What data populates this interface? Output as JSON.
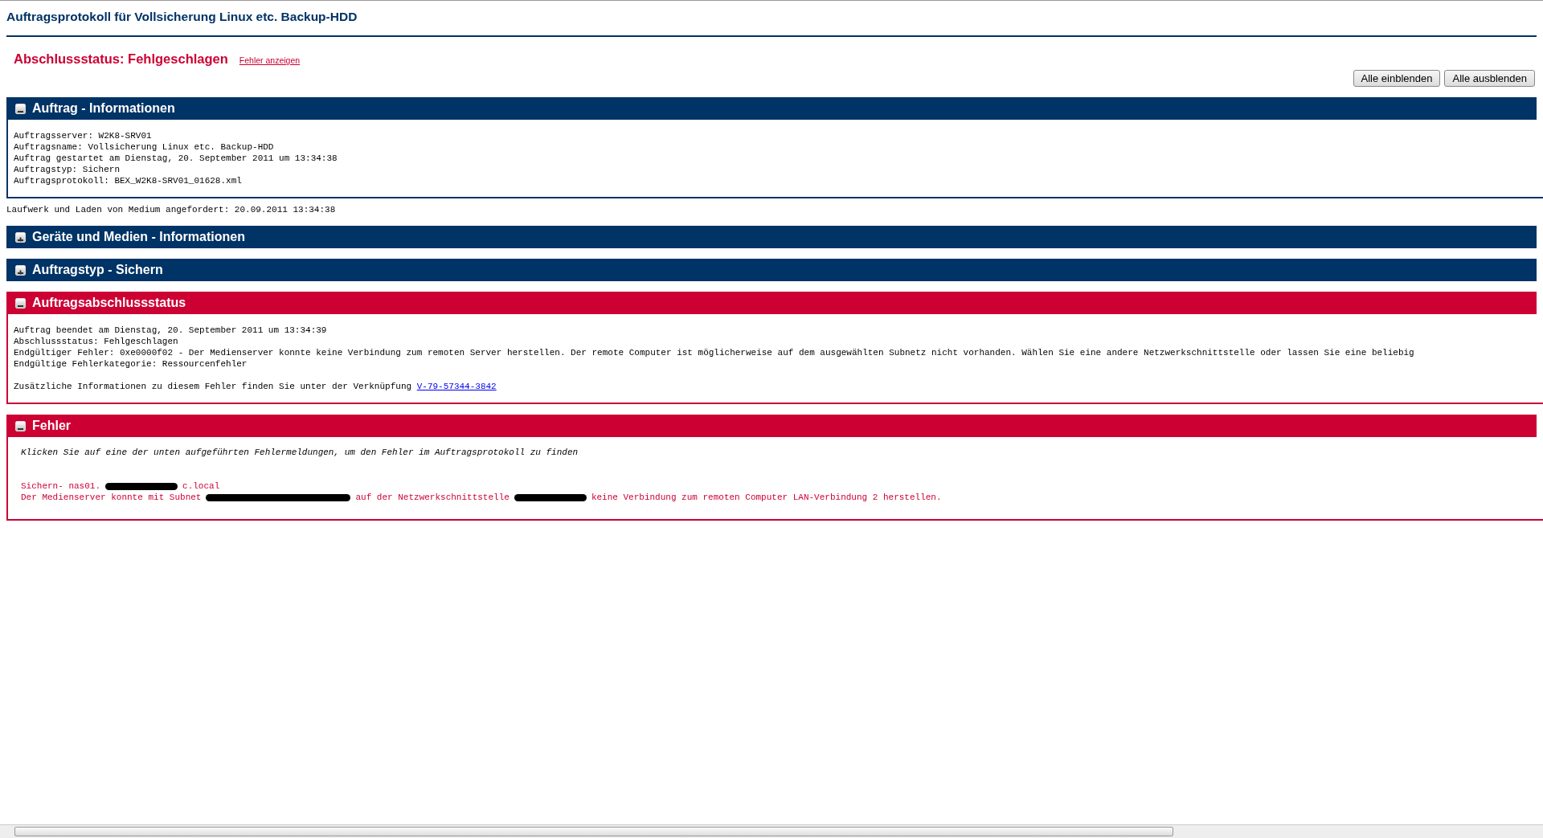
{
  "title": "Auftragsprotokoll für Vollsicherung Linux etc. Backup-HDD",
  "status": {
    "text": "Abschlussstatus: Fehlgeschlagen",
    "link": "Fehler anzeigen"
  },
  "buttons": [
    "Alle einblenden",
    "Alle ausblenden"
  ],
  "sections": [
    {
      "title": "Auftrag - Informationen",
      "kind": "info",
      "expanded": true,
      "lines": [
        {
          "text": "Auftragsserver: W2K8-SRV01"
        },
        {
          "text": "Auftragsname: Vollsicherung Linux etc. Backup-HDD"
        },
        {
          "text": "Auftrag gestartet am Dienstag, 20. September 2011 um 13:34:38"
        },
        {
          "text": "Auftragstyp: Sichern"
        },
        {
          "text": "Auftragsprotokoll: BEX_W2K8-SRV01_01628.xml"
        }
      ],
      "after": "Laufwerk und Laden von Medium angefordert: 20.09.2011 13:34:38"
    },
    {
      "title": "Geräte und Medien - Informationen",
      "kind": "info",
      "expanded": false
    },
    {
      "title": "Auftragstyp - Sichern",
      "kind": "info",
      "expanded": false
    },
    {
      "title": "Auftragsabschlussstatus",
      "kind": "error",
      "expanded": true,
      "lines": [
        {
          "text": "Auftrag beendet am Dienstag, 20. September 2011 um 13:34:39"
        },
        {
          "text": "Abschlussstatus: Fehlgeschlagen"
        },
        {
          "text": "Endgültiger Fehler: 0xe0000f02 - Der Medienserver konnte keine Verbindung zum remoten Server herstellen. Der remote Computer ist möglicherweise auf dem ausgewählten Subnetz nicht vorhanden. Wählen Sie eine andere Netzwerkschnittstelle oder lassen Sie eine beliebig"
        },
        {
          "text": "Endgültige Fehlerkategorie: Ressourcenfehler"
        },
        {
          "text": "Zusätzliche Informationen zu diesem Fehler finden Sie unter der Verknüpfung",
          "link": "V-79-57344-3842",
          "gap_before": true
        }
      ]
    },
    {
      "title": "Fehler",
      "kind": "error",
      "expanded": true,
      "intro": "Klicken Sie auf eine der unten aufgeführten Fehlermeldungen, um den Fehler im Auftragsprotokoll zu finden",
      "errors": [
        {
          "lines": [
            [
              {
                "kind": "text",
                "text": "Sichern- nas01."
              },
              {
                "kind": "redacted"
              },
              {
                "kind": "text",
                "text": "c.local"
              }
            ],
            [
              {
                "kind": "text",
                "text": "Der Medienserver konnte mit Subnet"
              },
              {
                "kind": "redacted"
              },
              {
                "kind": "text",
                "text": "auf der Netzwerkschnittstelle"
              },
              {
                "kind": "redacted"
              },
              {
                "kind": "text",
                "text": "keine Verbindung zum remoten Computer LAN-Verbindung 2 herstellen."
              }
            ]
          ]
        }
      ]
    }
  ]
}
